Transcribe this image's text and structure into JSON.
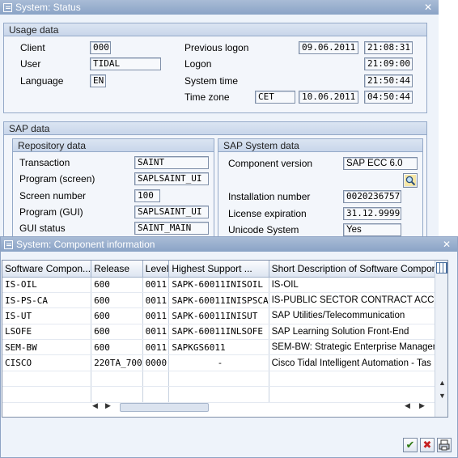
{
  "status_window": {
    "title": "System: Status",
    "usage_data": {
      "header": "Usage data",
      "client_label": "Client",
      "client_value": "000",
      "user_label": "User",
      "user_value": "TIDAL",
      "language_label": "Language",
      "language_value": "EN",
      "previous_logon_label": "Previous logon",
      "previous_logon_date": "09.06.2011",
      "previous_logon_time": "21:08:31",
      "logon_label": "Logon",
      "logon_time": "21:09:00",
      "system_time_label": "System time",
      "system_time_value": "21:50:44",
      "time_zone_label": "Time zone",
      "time_zone_value": "CET",
      "time_zone_date": "10.06.2011",
      "time_zone_time": "04:50:44"
    },
    "sap_data": {
      "header": "SAP data",
      "repository": {
        "header": "Repository data",
        "transaction_label": "Transaction",
        "transaction_value": "SAINT",
        "program_screen_label": "Program (screen)",
        "program_screen_value": "SAPLSAINT_UI",
        "screen_number_label": "Screen number",
        "screen_number_value": "100",
        "program_gui_label": "Program (GUI)",
        "program_gui_value": "SAPLSAINT_UI",
        "gui_status_label": "GUI status",
        "gui_status_value": "SAINT_MAIN"
      },
      "system": {
        "header": "SAP System data",
        "component_version_label": "Component version",
        "component_version_value": "SAP ECC 6.0",
        "installation_number_label": "Installation number",
        "installation_number_value": "0020236757",
        "license_expiration_label": "License expiration",
        "license_expiration_value": "31.12.9999",
        "unicode_label": "Unicode System",
        "unicode_value": "Yes"
      }
    }
  },
  "component_window": {
    "title": "System: Component information",
    "columns": [
      "Software Compon...",
      "Release",
      "Level",
      "Highest Support ...",
      "Short Description of Software Compon"
    ],
    "rows": [
      [
        "IS-OIL",
        "600",
        "0011",
        "SAPK-60011INISOIL",
        "IS-OIL"
      ],
      [
        "IS-PS-CA",
        "600",
        "0011",
        "SAPK-60011INISPSCA",
        "IS-PUBLIC SECTOR CONTRACT ACCOUNTING"
      ],
      [
        "IS-UT",
        "600",
        "0011",
        "SAPK-60011INISUT",
        "SAP Utilities/Telecommunication"
      ],
      [
        "LSOFE",
        "600",
        "0011",
        "SAPK-60011INLSOFE",
        "SAP Learning Solution Front-End"
      ],
      [
        "SEM-BW",
        "600",
        "0011",
        "SAPKGS6011",
        "SEM-BW: Strategic Enterprise Management"
      ],
      [
        "CISCO",
        "220TA_700",
        "0000",
        "-",
        "Cisco Tidal Intelligent Automation - Tas"
      ]
    ]
  }
}
